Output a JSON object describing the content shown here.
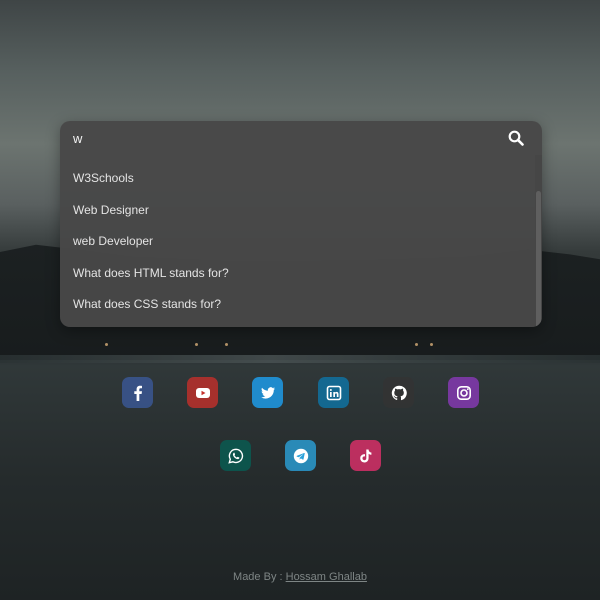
{
  "search": {
    "value": "w",
    "suggestions": [
      "W3Schools",
      "Web Designer",
      "web Developer",
      "What does HTML stands for?",
      "What does CSS stands for?"
    ]
  },
  "socials": {
    "row1": [
      {
        "name": "facebook",
        "color": "#3b5998"
      },
      {
        "name": "youtube",
        "color": "#c4302b"
      },
      {
        "name": "twitter",
        "color": "#1da1f2"
      },
      {
        "name": "linkedin",
        "color": "#0e76a8"
      },
      {
        "name": "github",
        "color": "#333333"
      },
      {
        "name": "instagram",
        "color": "#8a3ab9"
      }
    ],
    "row2": [
      {
        "name": "whatsapp",
        "color": "#075e54"
      },
      {
        "name": "telegram",
        "color": "#2aa1da"
      },
      {
        "name": "tiktok",
        "color": "#e1306c"
      }
    ]
  },
  "footer": {
    "prefix": "Made By :",
    "author": "Hossam Ghallab"
  }
}
